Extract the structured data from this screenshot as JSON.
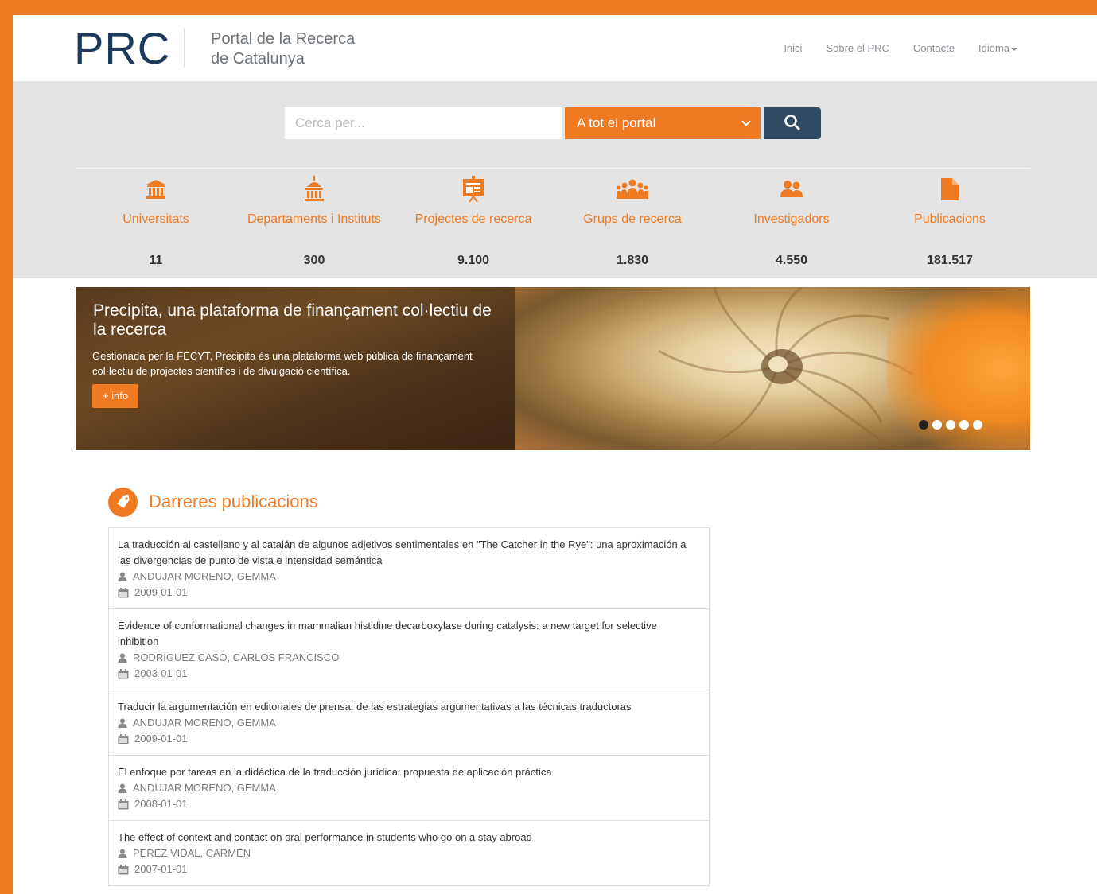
{
  "header": {
    "logo": "PRC",
    "subtitle_line1": "Portal de la Recerca",
    "subtitle_line2": "de Catalunya",
    "nav": [
      "Inici",
      "Sobre el PRC",
      "Contacte",
      "Idioma"
    ]
  },
  "search": {
    "placeholder": "Cerca per...",
    "scope": "A tot el portal"
  },
  "stats": [
    {
      "label": "Universitats",
      "value": "11",
      "icon": "university-icon"
    },
    {
      "label": "Departaments i Instituts",
      "value": "300",
      "icon": "institute-icon"
    },
    {
      "label": "Projectes de recerca",
      "value": "9.100",
      "icon": "projects-icon"
    },
    {
      "label": "Grups de recerca",
      "value": "1.830",
      "icon": "groups-icon"
    },
    {
      "label": "Investigadors",
      "value": "4.550",
      "icon": "researchers-icon"
    },
    {
      "label": "Publicacions",
      "value": "181.517",
      "icon": "document-icon"
    }
  ],
  "banner": {
    "title": "Precipita, una plataforma de finançament col·lectiu de la recerca",
    "text": "Gestionada per la FECYT, Precipita és una plataforma web pública de finançament col·lectiu de projectes científics i de divulgació científica.",
    "button": "+ info",
    "slides": 5,
    "active_slide": 1
  },
  "publications": {
    "heading": "Darreres publicacions",
    "items": [
      {
        "title": "La traducción al castellano y al catalán de algunos adjetivos sentimentales en \"The Catcher in the Rye\": una aproximación a las divergencias de punto de vista e intensidad semántica",
        "author": "ANDUJAR MORENO, GEMMA",
        "date": "2009-01-01"
      },
      {
        "title": "Evidence of conformational changes in mammalian histidine decarboxylase during catalysis: a new target for selective inhibition",
        "author": "RODRIGUEZ CASO, CARLOS FRANCISCO",
        "date": "2003-01-01"
      },
      {
        "title": "Traducir la argumentación en editoriales de prensa: de las estrategias argumentativas a las técnicas traductoras",
        "author": "ANDUJAR MORENO, GEMMA",
        "date": "2009-01-01"
      },
      {
        "title": "El enfoque por tareas en la didáctica de la traducción jurídica: propuesta de aplicación práctica",
        "author": "ANDUJAR MORENO, GEMMA",
        "date": "2008-01-01"
      },
      {
        "title": "The effect of context and contact on oral performance in students who go on a stay abroad",
        "author": "PEREZ VIDAL, CARMEN",
        "date": "2007-01-01"
      }
    ]
  },
  "colors": {
    "accent": "#f07a22",
    "dark": "#2f4a63",
    "band": "#e4e4e4"
  }
}
